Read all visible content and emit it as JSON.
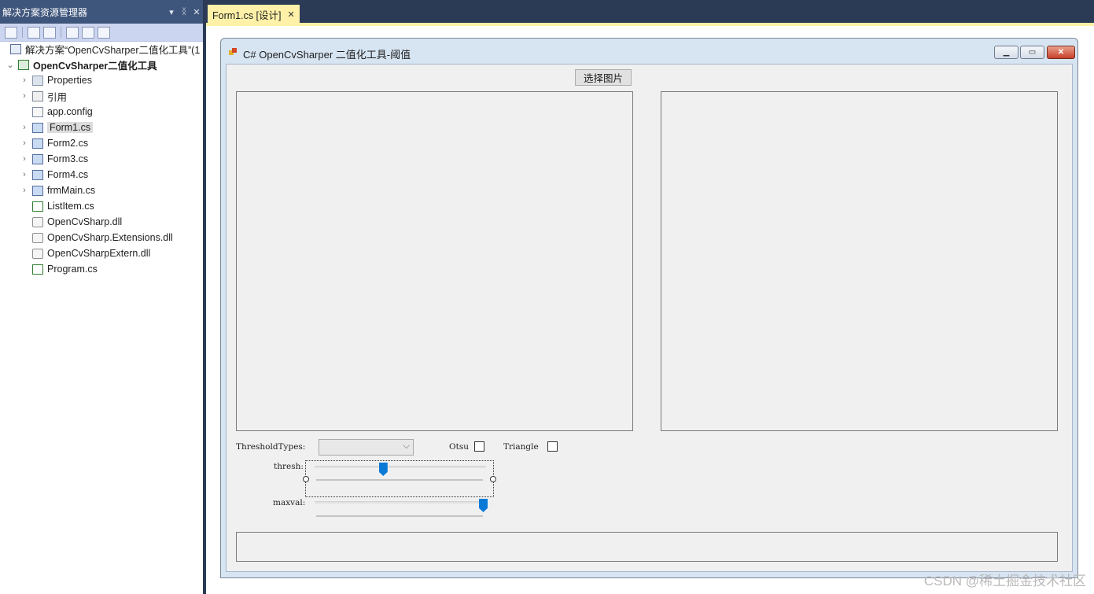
{
  "explorer": {
    "title": "解决方案资源管理器",
    "title_buttons": {
      "dropdown": "▾",
      "pin": "ᛝ",
      "close": "✕"
    },
    "tree": [
      {
        "label": "解决方案“OpenCvSharper二值化工具”(1",
        "icon": "solution-icon",
        "level": 0
      },
      {
        "label": "OpenCvSharper二值化工具",
        "icon": "csharp-project-icon",
        "level": 0,
        "expanded": true
      },
      {
        "label": "Properties",
        "icon": "properties-folder-icon",
        "level": 1
      },
      {
        "label": "引用",
        "icon": "references-icon",
        "level": 1
      },
      {
        "label": "app.config",
        "icon": "config-file-icon",
        "level": 1
      },
      {
        "label": "Form1.cs",
        "icon": "form-file-icon",
        "level": 1,
        "selected": true
      },
      {
        "label": "Form2.cs",
        "icon": "form-file-icon",
        "level": 1
      },
      {
        "label": "Form3.cs",
        "icon": "form-file-icon",
        "level": 1
      },
      {
        "label": "Form4.cs",
        "icon": "form-file-icon",
        "level": 1
      },
      {
        "label": "frmMain.cs",
        "icon": "form-file-icon",
        "level": 1
      },
      {
        "label": "ListItem.cs",
        "icon": "csharp-file-icon",
        "level": 1
      },
      {
        "label": "OpenCvSharp.dll",
        "icon": "dll-file-icon",
        "level": 1
      },
      {
        "label": "OpenCvSharp.Extensions.dll",
        "icon": "dll-file-icon",
        "level": 1
      },
      {
        "label": "OpenCvSharpExtern.dll",
        "icon": "dll-file-icon",
        "level": 1
      },
      {
        "label": "Program.cs",
        "icon": "csharp-file-icon",
        "level": 1
      }
    ]
  },
  "editor": {
    "tab_label": "Form1.cs [设计]",
    "tab_close": "✕"
  },
  "form": {
    "title": "C# OpenCvSharper 二值化工具-阈值",
    "select_button": "选择图片",
    "threshold_types_label": "ThresholdTypes:",
    "otsu_label": "Otsu",
    "triangle_label": "Triangle",
    "thresh_label": "thresh:",
    "maxval_label": "maxval:",
    "thresh_level": 0.4,
    "maxval_level": 1.0,
    "otsu_checked": false,
    "triangle_checked": false
  },
  "watermark": "CSDN @稀土掘金技术社区",
  "colors": {
    "explorer_title_bg": "#3f567c",
    "tab_active_bg": "#fff1a8",
    "slider_thumb": "#0b7ad7"
  }
}
